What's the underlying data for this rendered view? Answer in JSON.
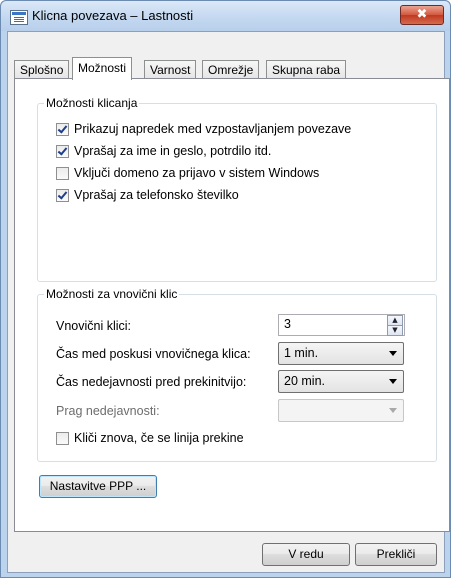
{
  "window": {
    "title": "Klicna povezava – Lastnosti",
    "close_glyph": "✖"
  },
  "tabs": [
    {
      "label": "Splošno"
    },
    {
      "label": "Možnosti"
    },
    {
      "label": "Varnost"
    },
    {
      "label": "Omrežje"
    },
    {
      "label": "Skupna raba"
    }
  ],
  "dial_options": {
    "legend": "Možnosti klicanja",
    "items": [
      {
        "label": "Prikazuj napredek med vzpostavljanjem povezave",
        "checked": true
      },
      {
        "label": "Vprašaj za ime in geslo, potrdilo itd.",
        "checked": true
      },
      {
        "label": "Vključi domeno za prijavo v sistem Windows",
        "checked": false
      },
      {
        "label": "Vprašaj za telefonsko številko",
        "checked": true
      }
    ]
  },
  "redial_options": {
    "legend": "Možnosti za vnovični klic",
    "redial_attempts_label": "Vnovični klici:",
    "redial_attempts_value": "3",
    "interval_label": "Čas med poskusi vnovičnega klica:",
    "interval_value": "1 min.",
    "idle_label": "Čas nedejavnosti pred prekinitvijo:",
    "idle_value": "20 min.",
    "threshold_label": "Prag nedejavnosti:",
    "threshold_value": "",
    "redial_if_dropped_label": "Kliči znova, če se linija prekine",
    "redial_if_dropped_checked": false
  },
  "ppp_button_label": "Nastavitve PPP ...",
  "footer": {
    "ok_label": "V redu",
    "cancel_label": "Prekliči"
  },
  "icons": {
    "title": "dialup-connection-icon",
    "close": "close-icon",
    "spin_up": "spin-up-arrow-icon",
    "spin_down": "spin-down-arrow-icon",
    "dropdown": "chevron-down-icon"
  }
}
